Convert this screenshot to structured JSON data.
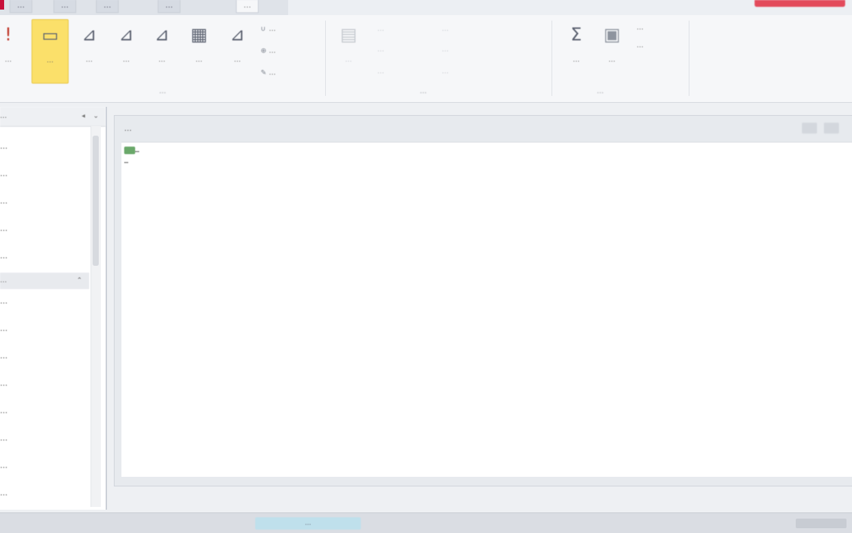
{
  "tabbar": {
    "tabs": [
      {
        "label": "…"
      },
      {
        "label": "…"
      },
      {
        "label": "…"
      },
      {
        "label": "…"
      },
      {
        "label": "…"
      }
    ]
  },
  "ribbon": {
    "large_buttons": [
      {
        "icon": "exclamation-icon",
        "label": "…"
      },
      {
        "icon": "view-icon",
        "label": "…"
      },
      {
        "icon": "query-design-icon",
        "label": "…"
      },
      {
        "icon": "query-design-icon",
        "label": "…"
      },
      {
        "icon": "query-design-icon",
        "label": "…"
      },
      {
        "icon": "table-icon",
        "label": "…"
      },
      {
        "icon": "query-design-icon",
        "label": "…"
      }
    ],
    "small_buttons": [
      {
        "icon": "union-icon",
        "label": "…"
      },
      {
        "icon": "pass-through-icon",
        "label": "…"
      },
      {
        "icon": "data-definition-icon",
        "label": "…"
      }
    ],
    "disabled_large": {
      "icon": "show-table-icon",
      "label": "…"
    },
    "setup_small_buttons": [
      {
        "label": "…"
      },
      {
        "label": "…"
      },
      {
        "label": "…"
      },
      {
        "label": "…"
      },
      {
        "label": "…"
      },
      {
        "label": "…"
      }
    ],
    "totals_buttons": [
      {
        "icon": "sigma-icon",
        "label": "…"
      },
      {
        "icon": "parameters-icon",
        "label": "…"
      }
    ],
    "showhide_small": [
      {
        "label": "…"
      },
      {
        "label": "…"
      }
    ],
    "group_labels": [
      "…",
      "…",
      "…"
    ]
  },
  "leftpane": {
    "header_label": "…",
    "items_top": [
      "…",
      "…",
      "…",
      "…",
      "…"
    ],
    "group2_label": "…",
    "items_bottom": [
      "…",
      "…",
      "…",
      "…",
      "…",
      "…",
      "…",
      "…"
    ]
  },
  "document": {
    "tab_label": "…",
    "code_lines": [
      {
        "text": "…"
      },
      {
        "text": "…"
      }
    ]
  },
  "statusbar": {
    "view_chip": "…"
  }
}
